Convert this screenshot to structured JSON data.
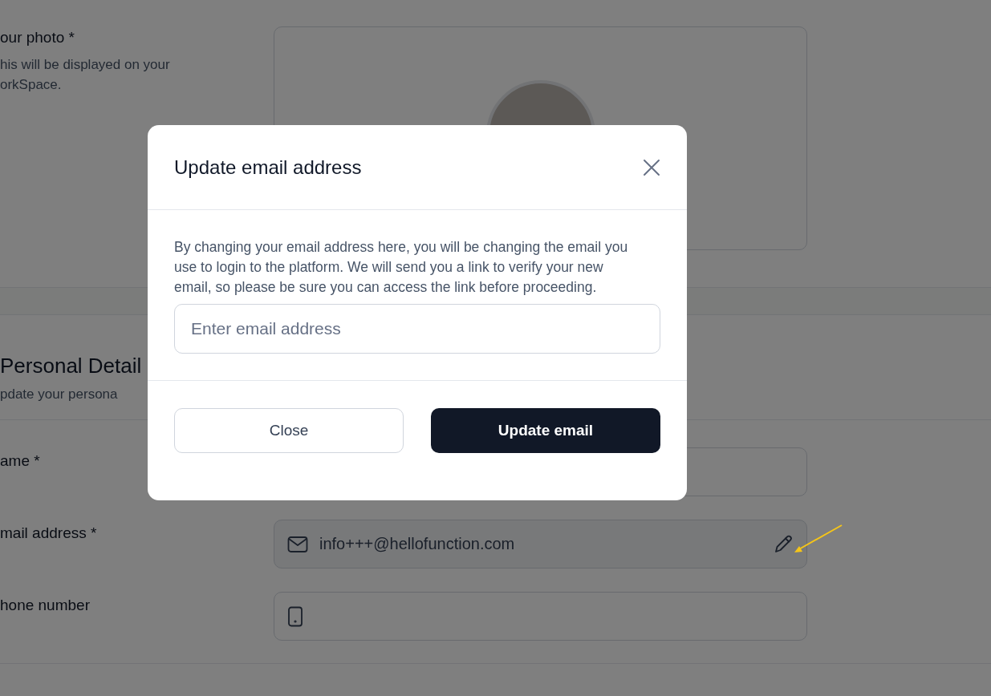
{
  "background": {
    "photo_section": {
      "label": "our photo *",
      "hint_lines": [
        "his will be displayed on your",
        "orkSpace."
      ]
    },
    "personal_section": {
      "title": "Personal Detail",
      "subtitle": "pdate your persona"
    },
    "fields": [
      {
        "kind": "text",
        "label": "ame *",
        "disabled": false
      },
      {
        "kind": "email",
        "label": "mail address *",
        "value": "info+++@hellofunction.com",
        "disabled": true
      },
      {
        "kind": "phone",
        "label": "hone number",
        "disabled": false
      }
    ]
  },
  "dialog": {
    "title": "Update email address",
    "body": "By changing your email address here, you will be changing the email you use to login to the platform. We will send you a link to verify your new email, so please be sure you can access the link before proceeding.",
    "input": {
      "placeholder": "Enter email address"
    },
    "buttons": [
      {
        "label": "Close",
        "kind": "secondary"
      },
      {
        "label": "Update email",
        "kind": "primary"
      }
    ]
  }
}
